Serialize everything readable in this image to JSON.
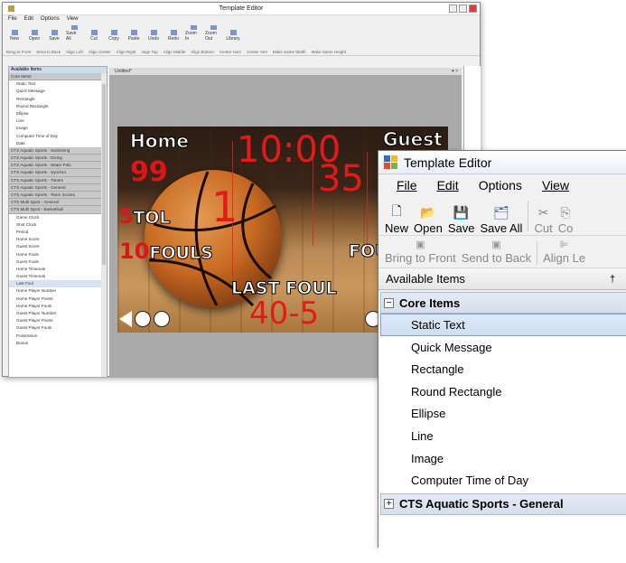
{
  "small_window": {
    "title": "Template Editor",
    "menu": [
      "File",
      "Edit",
      "Options",
      "View"
    ],
    "toolbar1": [
      "New",
      "Open",
      "Save",
      "Save All",
      "Cut",
      "Copy",
      "Paste",
      "Undo",
      "Redo",
      "Zoom In",
      "Zoom Out",
      "Library"
    ],
    "toolbar2": [
      "Bring to Front",
      "Send to Back",
      "Align Left",
      "Align Center",
      "Align Right",
      "Align Top",
      "Align Middle",
      "Align Bottom",
      "Center Horz",
      "Center Vert",
      "Make Same Width",
      "Make Same Height"
    ],
    "panel_title": "Available Items",
    "tab_title": "Untitled*",
    "items": [
      {
        "label": "Core Items",
        "type": "group"
      },
      {
        "label": "Static Text",
        "type": "item"
      },
      {
        "label": "Quick Message",
        "type": "item"
      },
      {
        "label": "Rectangle",
        "type": "item"
      },
      {
        "label": "Round Rectangle",
        "type": "item"
      },
      {
        "label": "Ellipse",
        "type": "item"
      },
      {
        "label": "Line",
        "type": "item"
      },
      {
        "label": "Image",
        "type": "item"
      },
      {
        "label": "Computer Time of Day",
        "type": "item"
      },
      {
        "label": "Date",
        "type": "item"
      },
      {
        "label": "CTS Aquatic Sports - Swimming",
        "type": "group"
      },
      {
        "label": "CTS Aquatic Sports - Diving",
        "type": "group"
      },
      {
        "label": "CTS Aquatic Sports - Water Polo",
        "type": "group"
      },
      {
        "label": "CTS Aquatic Sports - Synchro",
        "type": "group"
      },
      {
        "label": "CTS Aquatic Sports - Timers",
        "type": "group"
      },
      {
        "label": "CTS Aquatic Sports - General",
        "type": "group"
      },
      {
        "label": "CTS Aquatic Sports - Team Scores",
        "type": "group"
      },
      {
        "label": "CTS Multi Sport - General",
        "type": "group"
      },
      {
        "label": "CTS Multi Sport - Basketball",
        "type": "group"
      },
      {
        "label": "Game Clock",
        "type": "item"
      },
      {
        "label": "Shot Clock",
        "type": "item"
      },
      {
        "label": "Period",
        "type": "item"
      },
      {
        "label": "Home Score",
        "type": "item"
      },
      {
        "label": "Guest Score",
        "type": "item"
      },
      {
        "label": "Home Fouls",
        "type": "item"
      },
      {
        "label": "Guest Fouls",
        "type": "item"
      },
      {
        "label": "Home Timeouts",
        "type": "item"
      },
      {
        "label": "Guest Timeouts",
        "type": "item"
      },
      {
        "label": "Last Foul",
        "type": "item",
        "selected": true
      },
      {
        "label": "Home Player Number",
        "type": "item"
      },
      {
        "label": "Home Player Points",
        "type": "item"
      },
      {
        "label": "Home Player Fouls",
        "type": "item"
      },
      {
        "label": "Guest Player Number",
        "type": "item"
      },
      {
        "label": "Guest Player Points",
        "type": "item"
      },
      {
        "label": "Guest Player Fouls",
        "type": "item"
      },
      {
        "label": "Possession",
        "type": "item"
      },
      {
        "label": "Bonus",
        "type": "item"
      }
    ]
  },
  "scoreboard": {
    "home_label": "Home",
    "guest_label": "Guest",
    "clock": "10:00",
    "home_score": "99",
    "period": "1",
    "guest_score": "35",
    "tol_value": "5",
    "tol_label": "TOL",
    "fouls_value": "10",
    "fouls_label": "FOULS",
    "guest_fouls_label": "FOU",
    "last_foul_label": "LAST FOUL",
    "last_foul_value": "40-5"
  },
  "large_window": {
    "title": "Template Editor",
    "menu": {
      "file": "File",
      "edit": "Edit",
      "options": "Options",
      "view": "View"
    },
    "toolbar1": {
      "new": "New",
      "open": "Open",
      "save": "Save",
      "save_all": "Save All",
      "cut": "Cut",
      "copy": "Co"
    },
    "toolbar2": {
      "bring_front": "Bring to Front",
      "send_back": "Send to Back",
      "align_left": "Align Le"
    },
    "panel_title": "Available Items",
    "pin_glyph": "†",
    "groups": {
      "core": "Core Items",
      "aquatic_general": "CTS Aquatic Sports - General"
    },
    "items": [
      "Static Text",
      "Quick Message",
      "Rectangle",
      "Round Rectangle",
      "Ellipse",
      "Line",
      "Image",
      "Computer Time of Day"
    ]
  },
  "colors": {
    "accent": "#e11b1b",
    "selection": "#cfdef1",
    "group_header": "#d5dfec"
  }
}
